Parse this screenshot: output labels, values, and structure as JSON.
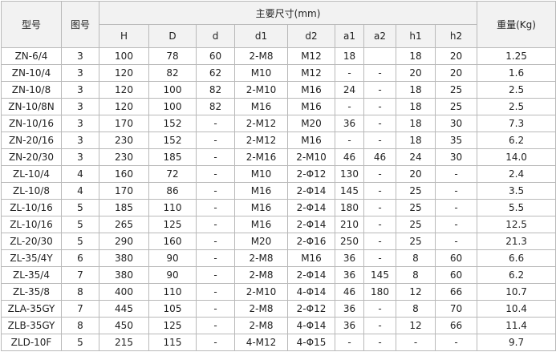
{
  "table": {
    "col_model": "型号",
    "col_figure": "图号",
    "col_dims_group": "主要尺寸(mm)",
    "col_weight": "重量(Kg)",
    "dim_columns": [
      "H",
      "D",
      "d",
      "d1",
      "d2",
      "a1",
      "a2",
      "h1",
      "h2"
    ],
    "rows": [
      [
        "ZN-6/4",
        "3",
        "100",
        "78",
        "60",
        "2-M8",
        "M12",
        "18",
        "",
        "18",
        "20",
        "1.25"
      ],
      [
        "ZN-10/4",
        "3",
        "120",
        "82",
        "62",
        "M10",
        "M12",
        "-",
        "-",
        "20",
        "20",
        "1.6"
      ],
      [
        "ZN-10/8",
        "3",
        "120",
        "100",
        "82",
        "2-M10",
        "M16",
        "24",
        "-",
        "18",
        "25",
        "2.5"
      ],
      [
        "ZN-10/8N",
        "3",
        "120",
        "100",
        "82",
        "M16",
        "M16",
        "-",
        "-",
        "18",
        "25",
        "2.5"
      ],
      [
        "ZN-10/16",
        "3",
        "170",
        "152",
        "-",
        "2-M12",
        "M20",
        "36",
        "-",
        "18",
        "30",
        "7.3"
      ],
      [
        "ZN-20/16",
        "3",
        "230",
        "152",
        "-",
        "2-M12",
        "M16",
        "-",
        "-",
        "18",
        "35",
        "6.2"
      ],
      [
        "ZN-20/30",
        "3",
        "230",
        "185",
        "-",
        "2-M16",
        "2-M10",
        "46",
        "46",
        "24",
        "30",
        "14.0"
      ],
      [
        "ZL-10/4",
        "4",
        "160",
        "72",
        "-",
        "M10",
        "2-Φ12",
        "130",
        "-",
        "20",
        "-",
        "2.4"
      ],
      [
        "ZL-10/8",
        "4",
        "170",
        "86",
        "-",
        "M16",
        "2-Φ14",
        "145",
        "-",
        "25",
        "-",
        "3.5"
      ],
      [
        "ZL-10/16",
        "5",
        "185",
        "110",
        "-",
        "M16",
        "2-Φ14",
        "180",
        "-",
        "25",
        "-",
        "5.5"
      ],
      [
        "ZL-10/16",
        "5",
        "265",
        "125",
        "-",
        "M16",
        "2-Φ14",
        "210",
        "-",
        "25",
        "-",
        "12.5"
      ],
      [
        "ZL-20/30",
        "5",
        "290",
        "160",
        "-",
        "M20",
        "2-Φ16",
        "250",
        "-",
        "25",
        "-",
        "21.3"
      ],
      [
        "ZL-35/4Y",
        "6",
        "380",
        "90",
        "-",
        "2-M8",
        "M16",
        "36",
        "-",
        "8",
        "60",
        "6.6"
      ],
      [
        "ZL-35/4",
        "7",
        "380",
        "90",
        "-",
        "2-M8",
        "2-Φ14",
        "36",
        "145",
        "8",
        "60",
        "6.2"
      ],
      [
        "ZL-35/8",
        "8",
        "400",
        "110",
        "-",
        "2-M10",
        "4-Φ14",
        "46",
        "180",
        "12",
        "66",
        "10.7"
      ],
      [
        "ZLA-35GY",
        "7",
        "445",
        "105",
        "-",
        "2-M8",
        "2-Φ12",
        "36",
        "-",
        "8",
        "70",
        "10.4"
      ],
      [
        "ZLB-35GY",
        "8",
        "450",
        "125",
        "-",
        "2-M8",
        "4-Φ14",
        "36",
        "-",
        "12",
        "66",
        "11.4"
      ],
      [
        "ZLD-10F",
        "5",
        "215",
        "115",
        "-",
        "4-M12",
        "4-Φ15",
        "-",
        "-",
        "-",
        "-",
        "9.7"
      ]
    ]
  }
}
